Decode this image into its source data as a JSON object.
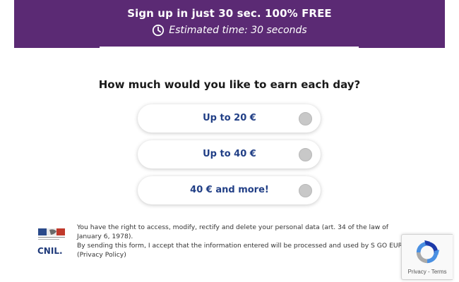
{
  "banner": {
    "title": "Sign up in just 30 sec. 100% FREE",
    "subtitle": "Estimated time: 30 seconds",
    "background": "#5b2a74"
  },
  "question": "How much would you like to earn each day?",
  "options": [
    {
      "label": "Up to 20 €",
      "selected": false
    },
    {
      "label": "Up to 40 €",
      "selected": false
    },
    {
      "label": "40 € and more!",
      "selected": false
    }
  ],
  "legal": {
    "line1": "You have the right to access, modify, rectify and delete your personal data (art. 34 of the law of January 6, 1978).",
    "line2": "By sending this form, I accept that the information entered will be processed and used by S GO EURL. (Privacy Policy)"
  },
  "cnil_logo": {
    "text": "CNIL."
  },
  "recaptcha": {
    "privacy": "Privacy",
    "separator": " - ",
    "terms": "Terms"
  },
  "colors": {
    "accent": "#213f86",
    "radio": "#c8c8c8"
  }
}
